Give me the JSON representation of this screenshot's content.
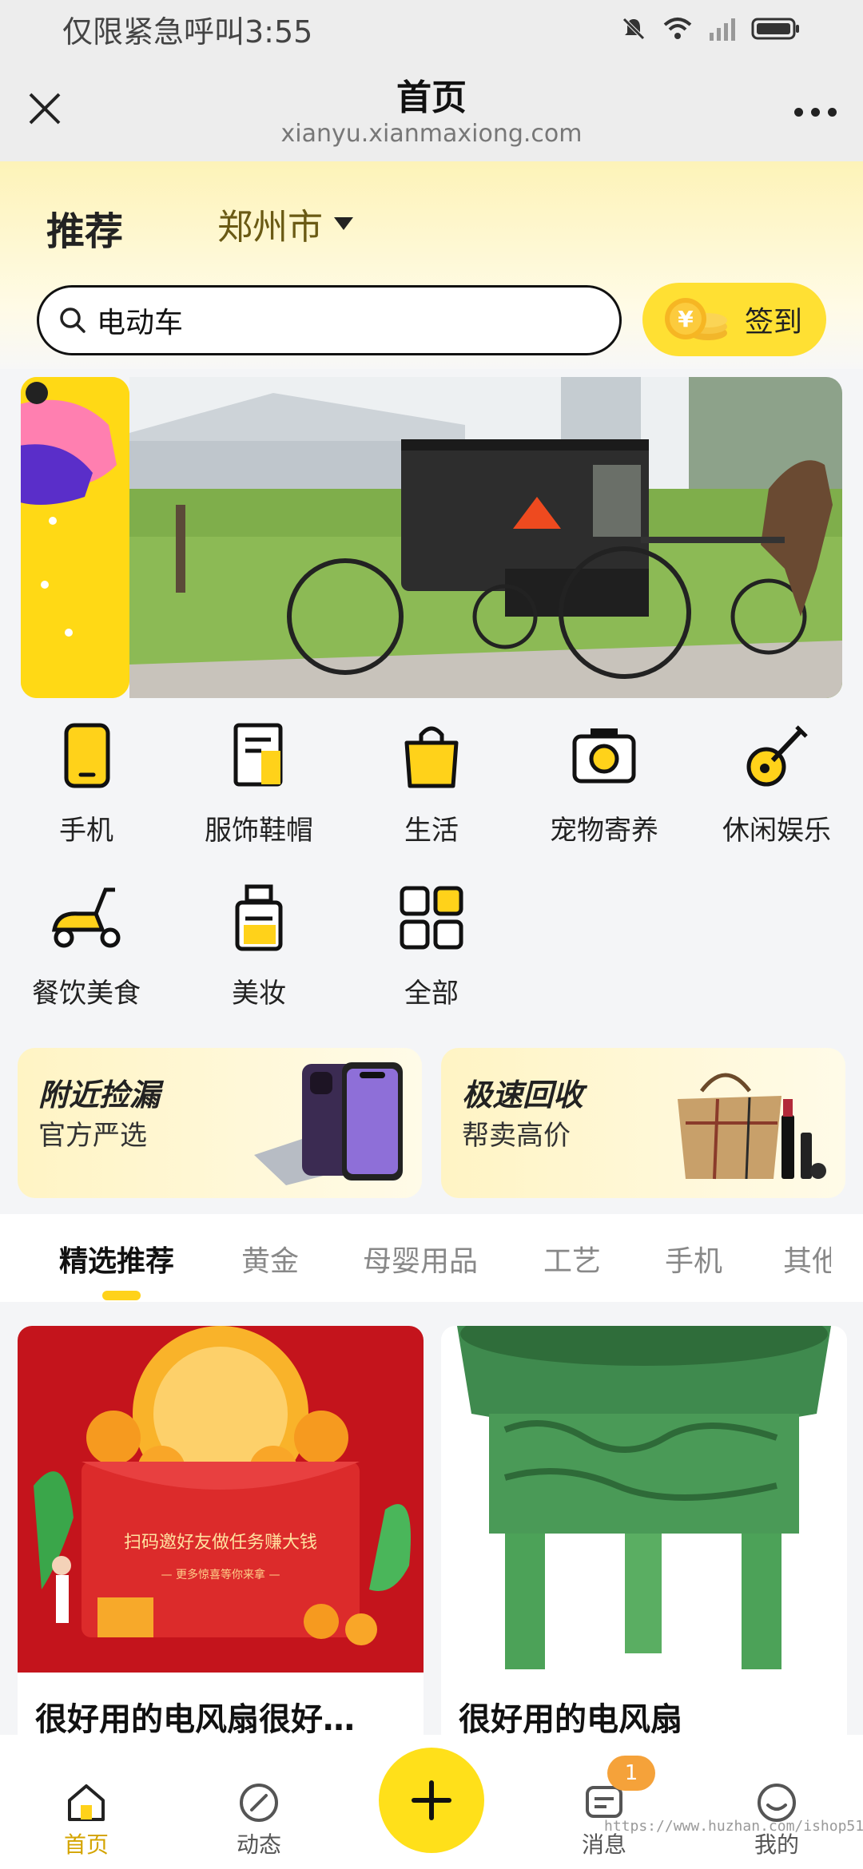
{
  "status_bar": {
    "text": "仅限紧急呼叫3:55"
  },
  "titlebar": {
    "title": "首页",
    "url": "xianyu.xianmaxiong.com"
  },
  "header": {
    "recommend_label": "推荐",
    "city": "郑州市",
    "search_value": "电动车",
    "signin_label": "签到"
  },
  "categories": [
    {
      "label": "手机",
      "icon": "phone-icon"
    },
    {
      "label": "服饰鞋帽",
      "icon": "clothing-icon"
    },
    {
      "label": "生活",
      "icon": "shopping-bag-icon"
    },
    {
      "label": "宠物寄养",
      "icon": "camera-icon"
    },
    {
      "label": "休闲娱乐",
      "icon": "guitar-icon"
    },
    {
      "label": "餐饮美食",
      "icon": "scooter-icon"
    },
    {
      "label": "美妆",
      "icon": "perfume-icon"
    },
    {
      "label": "全部",
      "icon": "grid-icon"
    }
  ],
  "promos": [
    {
      "title": "附近捡漏",
      "subtitle": "官方严选"
    },
    {
      "title": "极速回收",
      "subtitle": "帮卖高价"
    }
  ],
  "tabs": [
    "精选推荐",
    "黄金",
    "母婴用品",
    "工艺",
    "手机",
    "其他"
  ],
  "products": [
    {
      "title": "很好用的电风扇很好用的电风扇",
      "title_display": "很好用的电风扇很好…",
      "image_text": "扫码邀好友做任务赚大钱",
      "image_subtext": "— 更多惊喜等你来拿 —"
    },
    {
      "title": "很好用的电风扇"
    }
  ],
  "bottom_nav": [
    {
      "label": "首页",
      "icon": "home-icon",
      "active": true
    },
    {
      "label": "动态",
      "icon": "compass-icon"
    },
    {
      "label": "消息",
      "icon": "message-icon",
      "badge": "1"
    },
    {
      "label": "我的",
      "icon": "profile-icon"
    }
  ],
  "watermark": "https://www.huzhan.com/ishop51679",
  "colors": {
    "accent": "#ffe01a",
    "active_nav": "#d4a400",
    "badge": "#f5a23a"
  }
}
